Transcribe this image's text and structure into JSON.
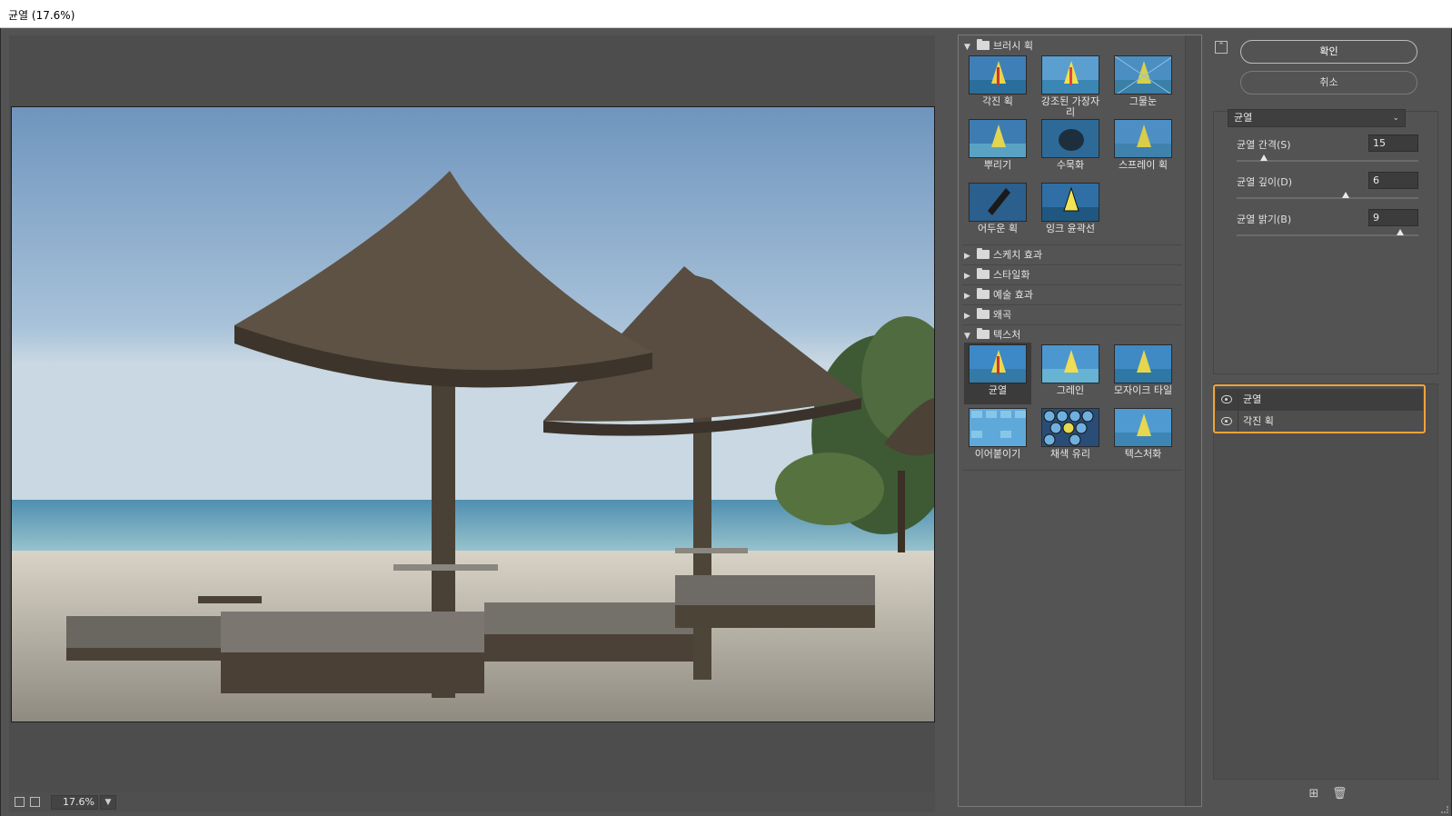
{
  "window": {
    "title": "균열 (17.6%)"
  },
  "statusbar": {
    "zoom_value": "17.6%",
    "zoom_dropdown_icon": "chevron-down-icon"
  },
  "gallery": {
    "folders": {
      "brush": {
        "label": "브러시 획",
        "expanded": true
      },
      "sketch": {
        "label": "스케치 효과",
        "expanded": false
      },
      "stylize": {
        "label": "스타일화",
        "expanded": false
      },
      "artistic": {
        "label": "예술 효과",
        "expanded": false
      },
      "distort": {
        "label": "왜곡",
        "expanded": false
      },
      "texture": {
        "label": "텍스처",
        "expanded": true
      }
    },
    "brush_thumbs": [
      "각진 획",
      "강조된 가장자리",
      "그물눈",
      "뿌리기",
      "수묵화",
      "스프레이 획",
      "어두운 획",
      "잉크 윤곽선"
    ],
    "texture_thumbs": [
      "균열",
      "그레인",
      "모자이크 타일",
      "이어붙이기",
      "채색 유리",
      "텍스처화"
    ],
    "selected_thumb": "균열"
  },
  "buttons": {
    "ok": "확인",
    "cancel": "취소"
  },
  "filter_select": {
    "value": "균열"
  },
  "params": [
    {
      "label": "균열 간격(S)",
      "value": "15",
      "fraction": 0.15
    },
    {
      "label": "균열 깊이(D)",
      "value": "6",
      "fraction": 0.6
    },
    {
      "label": "균열 밝기(B)",
      "value": "9",
      "fraction": 0.9
    }
  ],
  "layers": [
    {
      "name": "균열",
      "visible": true,
      "active": true
    },
    {
      "name": "각진 획",
      "visible": true,
      "active": false
    }
  ],
  "colors": {
    "accent_highlight": "#f0a33a",
    "panel_bg": "#535353"
  }
}
